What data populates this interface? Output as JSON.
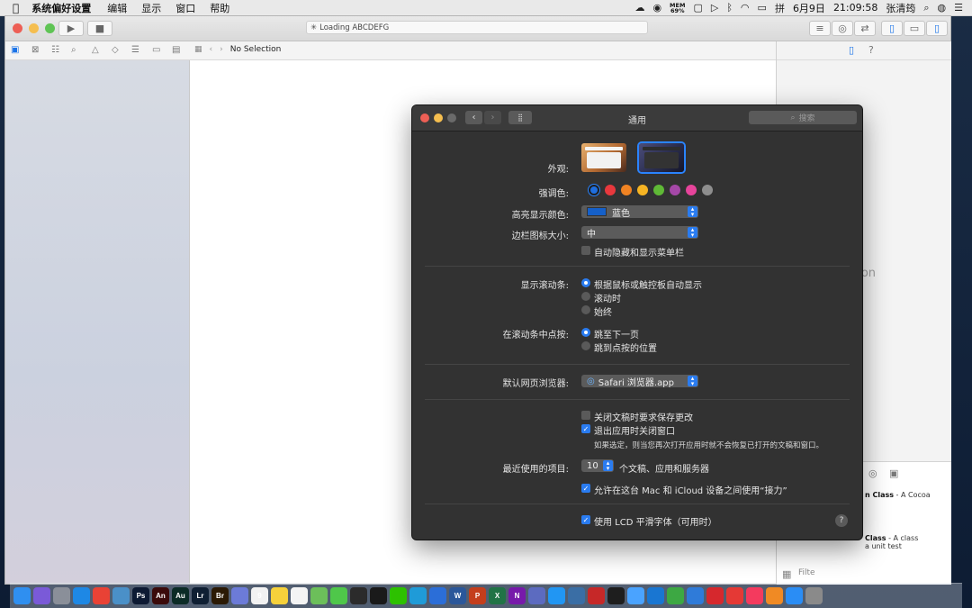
{
  "menubar": {
    "app": "系统偏好设置",
    "items": [
      "编辑",
      "显示",
      "窗口",
      "帮助"
    ],
    "mem_label": "MEM",
    "mem_value": "69%",
    "date": "6月9日",
    "time": "21:09:58",
    "user": "张清筠"
  },
  "xcode": {
    "activity_text": "Loading ABCDEFG",
    "jump_bar": "No Selection",
    "inspector_placeholder": "ection",
    "library": [
      {
        "name": "n Class",
        "desc": " - A Cocoa"
      },
      {
        "name": "Class",
        "desc": " - A class",
        "desc2": "a unit test"
      }
    ],
    "filter_placeholder": "Filte"
  },
  "prefs": {
    "title": "通用",
    "search_placeholder": "搜索",
    "appearance_label": "外观:",
    "accent_label": "强调色:",
    "accent_colors": [
      "#1f6fe0",
      "#e8383d",
      "#f08323",
      "#f6b423",
      "#5fb936",
      "#a548a8",
      "#e7449b",
      "#8e8e8e"
    ],
    "highlight_label": "高亮显示颜色:",
    "highlight_value": "蓝色",
    "sidebar_icon_label": "边栏图标大小:",
    "sidebar_icon_value": "中",
    "auto_hide_menu": "自动隐藏和显示菜单栏",
    "show_scrollbars_label": "显示滚动条:",
    "scroll_options": [
      "根据鼠标或触控板自动显示",
      "滚动时",
      "始终"
    ],
    "click_scrollbar_label": "在滚动条中点按:",
    "click_options": [
      "跳至下一页",
      "跳到点按的位置"
    ],
    "browser_label": "默认网页浏览器:",
    "browser_value": "Safari 浏览器.app",
    "ask_save": "关闭文稿时要求保存更改",
    "close_windows": "退出应用时关闭窗口",
    "close_windows_note": "如果选定，则当您再次打开应用时就不会恢复已打开的文稿和窗口。",
    "recent_label": "最近使用的项目:",
    "recent_value": "10",
    "recent_suffix": "个文稿、应用和服务器",
    "handoff": "允许在这台 Mac 和 iCloud 设备之间使用“接力”",
    "lcd": "使用 LCD 平滑字体（可用时）",
    "help": "?"
  },
  "dock": {
    "apps": [
      {
        "name": "finder",
        "label": "",
        "color": "#2f8ff0"
      },
      {
        "name": "siri",
        "label": "",
        "color": "#7a5ad8"
      },
      {
        "name": "launchpad",
        "label": "",
        "color": "#8a8f99"
      },
      {
        "name": "safari",
        "label": "",
        "color": "#1e88e5"
      },
      {
        "name": "chrome",
        "label": "",
        "color": "#e94235"
      },
      {
        "name": "preview",
        "label": "",
        "color": "#4a90c8"
      },
      {
        "name": "photoshop",
        "label": "Ps",
        "color": "#0d1a33"
      },
      {
        "name": "animate",
        "label": "An",
        "color": "#3a0a0a"
      },
      {
        "name": "audition",
        "label": "Au",
        "color": "#0b2b26"
      },
      {
        "name": "lightroom",
        "label": "Lr",
        "color": "#0f1f33"
      },
      {
        "name": "bridge",
        "label": "Br",
        "color": "#2b1a05"
      },
      {
        "name": "discord",
        "label": "",
        "color": "#6c7bd8"
      },
      {
        "name": "calendar",
        "label": "9",
        "color": "#f2f2f2"
      },
      {
        "name": "notes",
        "label": "",
        "color": "#f6d13b"
      },
      {
        "name": "photos",
        "label": "",
        "color": "#f4f4f4"
      },
      {
        "name": "maps",
        "label": "",
        "color": "#6cbf5a"
      },
      {
        "name": "messages",
        "label": "",
        "color": "#4fc74a"
      },
      {
        "name": "video",
        "label": "",
        "color": "#2b2b2b"
      },
      {
        "name": "qq",
        "label": "",
        "color": "#1a1a1a"
      },
      {
        "name": "wechat",
        "label": "",
        "color": "#2dc100"
      },
      {
        "name": "edge",
        "label": "",
        "color": "#1f9bd8"
      },
      {
        "name": "thunder",
        "label": "",
        "color": "#2b6ed8"
      },
      {
        "name": "word",
        "label": "W",
        "color": "#2b579a"
      },
      {
        "name": "powerpoint",
        "label": "P",
        "color": "#c43e1c"
      },
      {
        "name": "excel",
        "label": "X",
        "color": "#217346"
      },
      {
        "name": "onenote",
        "label": "N",
        "color": "#7719aa"
      },
      {
        "name": "app1",
        "label": "",
        "color": "#5c6bc0"
      },
      {
        "name": "app2",
        "label": "",
        "color": "#2196f3"
      },
      {
        "name": "app3",
        "label": "",
        "color": "#3a6ea5"
      },
      {
        "name": "app4",
        "label": "",
        "color": "#c62828"
      },
      {
        "name": "terminal",
        "label": "",
        "color": "#1e1e1e"
      },
      {
        "name": "icloud",
        "label": "",
        "color": "#4aa3ff"
      },
      {
        "name": "app5",
        "label": "",
        "color": "#1976d2"
      },
      {
        "name": "numbers",
        "label": "",
        "color": "#3da843"
      },
      {
        "name": "keynote",
        "label": "",
        "color": "#2f7bd9"
      },
      {
        "name": "netease",
        "label": "",
        "color": "#d6282d"
      },
      {
        "name": "app6",
        "label": "",
        "color": "#e53935"
      },
      {
        "name": "music",
        "label": "",
        "color": "#f43a5e"
      },
      {
        "name": "books",
        "label": "",
        "color": "#f08a24"
      },
      {
        "name": "appstore",
        "label": "",
        "color": "#2a8df5"
      },
      {
        "name": "prefs",
        "label": "",
        "color": "#8a8a8a"
      }
    ]
  }
}
